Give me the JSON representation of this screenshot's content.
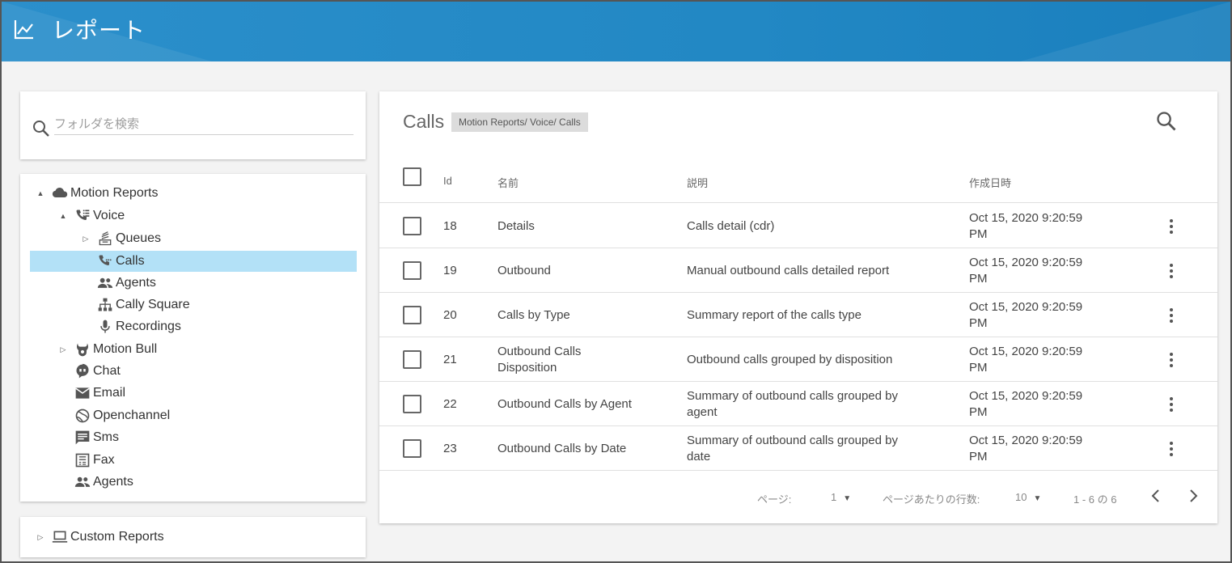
{
  "header": {
    "title": "レポート",
    "icon": "chart-line-icon"
  },
  "search": {
    "placeholder": "フォルダを検索"
  },
  "tree": [
    {
      "label": "Motion Reports",
      "icon": "cloud-icon",
      "toggle": "▲"
    },
    {
      "label": "Voice",
      "icon": "phone-list-icon",
      "toggle": "▲"
    },
    {
      "label": "Queues",
      "icon": "queue-stack-icon",
      "toggle": "▷"
    },
    {
      "label": "Calls",
      "icon": "phone-forward-icon",
      "toggle": ""
    },
    {
      "label": "Agents",
      "icon": "people-icon",
      "toggle": ""
    },
    {
      "label": "Cally Square",
      "icon": "hierarchy-icon",
      "toggle": ""
    },
    {
      "label": "Recordings",
      "icon": "microphone-icon",
      "toggle": ""
    },
    {
      "label": "Motion Bull",
      "icon": "bull-icon",
      "toggle": "▷"
    },
    {
      "label": "Chat",
      "icon": "chat-bubble-icon",
      "toggle": ""
    },
    {
      "label": "Email",
      "icon": "envelope-icon",
      "toggle": ""
    },
    {
      "label": "Openchannel",
      "icon": "globe-icon",
      "toggle": ""
    },
    {
      "label": "Sms",
      "icon": "message-icon",
      "toggle": ""
    },
    {
      "label": "Fax",
      "icon": "fax-icon",
      "toggle": ""
    },
    {
      "label": "Agents",
      "icon": "people-icon",
      "toggle": ""
    }
  ],
  "custom": {
    "label": "Custom Reports",
    "icon": "laptop-icon",
    "toggle": "▷"
  },
  "main": {
    "title": "Calls",
    "breadcrumb": "Motion Reports/ Voice/ Calls",
    "columns": {
      "id": "Id",
      "name": "名前",
      "description": "説明",
      "created": "作成日時"
    },
    "rows": [
      {
        "id": "18",
        "name": "Details",
        "description": "Calls detail (cdr)",
        "created": "Oct 15, 2020 9:20:59 PM"
      },
      {
        "id": "19",
        "name": "Outbound",
        "description": "Manual outbound calls detailed report",
        "created": "Oct 15, 2020 9:20:59 PM"
      },
      {
        "id": "20",
        "name": "Calls by Type",
        "description": "Summary report of the calls type",
        "created": "Oct 15, 2020 9:20:59 PM"
      },
      {
        "id": "21",
        "name": "Outbound Calls Disposition",
        "description": "Outbound calls grouped by disposition",
        "created": "Oct 15, 2020 9:20:59 PM"
      },
      {
        "id": "22",
        "name": "Outbound Calls by Agent",
        "description": "Summary of outbound calls grouped by agent",
        "created": "Oct 15, 2020 9:20:59 PM"
      },
      {
        "id": "23",
        "name": "Outbound Calls by Date",
        "description": "Summary of outbound calls grouped by date",
        "created": "Oct 15, 2020 9:20:59 PM"
      }
    ],
    "pager": {
      "page_label": "ページ:",
      "page_value": "1",
      "rows_label": "ページあたりの行数:",
      "rows_value": "10",
      "range": "1 - 6 の 6"
    }
  }
}
